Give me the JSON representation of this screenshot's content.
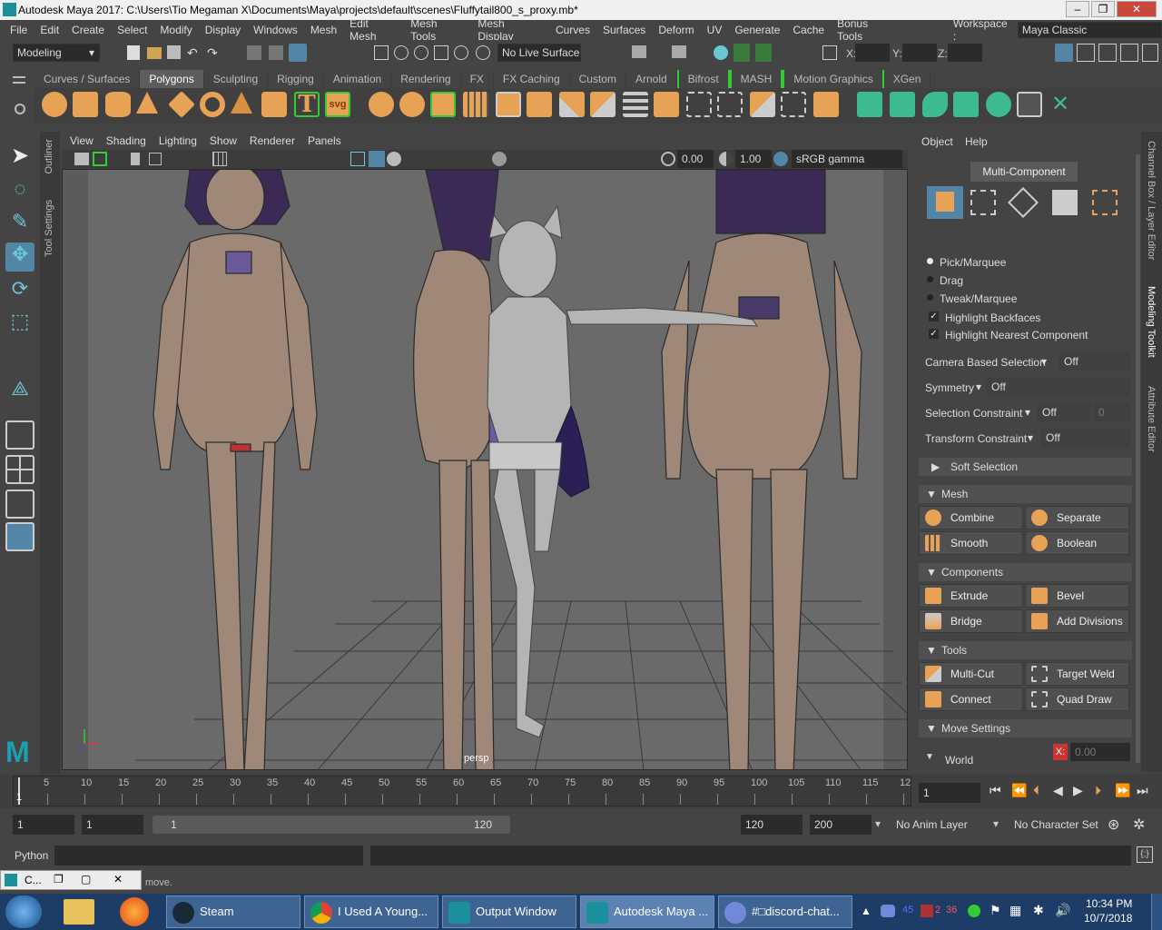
{
  "window": {
    "title": "Autodesk Maya 2017: C:\\Users\\Tio Megaman X\\Documents\\Maya\\projects\\default\\scenes\\Fluffytail800_s_proxy.mb*"
  },
  "menu": [
    "File",
    "Edit",
    "Create",
    "Select",
    "Modify",
    "Display",
    "Windows",
    "Mesh",
    "Edit Mesh",
    "Mesh Tools",
    "Mesh Display",
    "Curves",
    "Surfaces",
    "Deform",
    "UV",
    "Generate",
    "Cache",
    "Bonus Tools"
  ],
  "workspace": {
    "label": "Workspace :",
    "value": "Maya Classic"
  },
  "status": {
    "mode": "Modeling",
    "live_surface": "No Live Surface",
    "x_label": "X:",
    "y_label": "Y:",
    "z_label": "Z:"
  },
  "shelf_tabs": [
    "Curves / Surfaces",
    "Polygons",
    "Sculpting",
    "Rigging",
    "Animation",
    "Rendering",
    "FX",
    "FX Caching",
    "Custom",
    "Arnold",
    "Bifrost",
    "MASH",
    "Motion Graphics",
    "XGen"
  ],
  "shelf_icons": {
    "text_icon": "T",
    "svg_icon": "svg"
  },
  "side_tabs": {
    "outliner": "Outliner",
    "tool_settings": "Tool Settings"
  },
  "panel_menu": [
    "View",
    "Shading",
    "Lighting",
    "Show",
    "Renderer",
    "Panels"
  ],
  "view_toolbar": {
    "exposure": "0.00",
    "gamma": "1.00",
    "color_space": "sRGB gamma"
  },
  "viewport": {
    "camera": "persp",
    "axis_x": "x",
    "axis_y": "y"
  },
  "toolkit": {
    "menu": [
      "Object",
      "Help"
    ],
    "mode": "Multi-Component",
    "selection": [
      "Pick/Marquee",
      "Drag",
      "Tweak/Marquee"
    ],
    "checks": [
      "Highlight Backfaces",
      "Highlight Nearest Component"
    ],
    "props": [
      {
        "label": "Camera Based Selection",
        "value": "Off"
      },
      {
        "label": "Symmetry",
        "value": "Off"
      },
      {
        "label": "Selection Constraint",
        "value": "Off",
        "extra": "0"
      },
      {
        "label": "Transform Constraint",
        "value": "Off"
      }
    ],
    "soft_selection": "Soft Selection",
    "mesh_header": "Mesh",
    "mesh": [
      "Combine",
      "Separate",
      "Smooth",
      "Boolean"
    ],
    "components_header": "Components",
    "components": [
      "Extrude",
      "Bevel",
      "Bridge",
      "Add Divisions"
    ],
    "tools_header": "Tools",
    "tools": [
      "Multi-Cut",
      "Target Weld",
      "Connect",
      "Quad Draw"
    ],
    "move_header": "Move Settings",
    "world": "World",
    "x_label": "X:",
    "x_value": "0.00"
  },
  "right_tabs": [
    "Channel Box / Layer Editor",
    "Modeling Toolkit",
    "Attribute Editor"
  ],
  "timeline": {
    "ticks": [
      "5",
      "10",
      "15",
      "20",
      "25",
      "30",
      "35",
      "40",
      "45",
      "50",
      "55",
      "60",
      "65",
      "70",
      "75",
      "80",
      "85",
      "90",
      "95",
      "100",
      "105",
      "110",
      "115",
      "12"
    ],
    "start_marker": "1",
    "current": "1"
  },
  "range": {
    "start": "1",
    "start2": "1",
    "slider_start": "1",
    "slider_end": "120",
    "end": "120",
    "end2": "200",
    "anim_layer": "No Anim Layer",
    "char_set": "No Character Set"
  },
  "cmd": {
    "label": "Python"
  },
  "help": {
    "text": "move."
  },
  "mini_window": {
    "title": "C..."
  },
  "taskbar": {
    "items": [
      "Steam",
      "I Used A Young...",
      "Output Window",
      "Autodesk Maya ...",
      "#□discord-chat..."
    ],
    "tray": {
      "n1": "45",
      "n2": "2",
      "n3": "36"
    },
    "time": "10:34 PM",
    "date": "10/7/2018"
  },
  "colors": {
    "accent_orange": "#e8a255",
    "selected_blue": "#5285a6",
    "bg": "#444444",
    "viewport_bg": "#5b5b5b"
  }
}
